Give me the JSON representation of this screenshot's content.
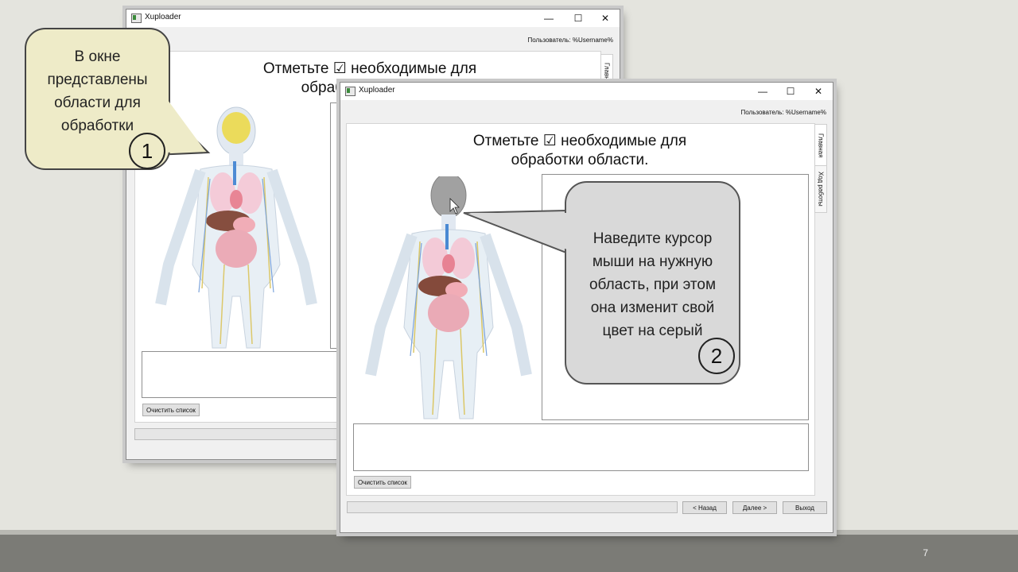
{
  "slide": {
    "page_number": "7"
  },
  "window_back": {
    "title": "Xuploader",
    "user_label": "Пользователь:  %Username%",
    "heading_line1": "Отметьте ☑ необходимые для",
    "heading_line2": "обработки области.",
    "tab_main": "Главная",
    "clear_button": "Очистить список"
  },
  "window_front": {
    "title": "Xuploader",
    "user_label": "Пользователь:  %Username%",
    "heading_line1": "Отметьте ☑ необходимые для",
    "heading_line2": "обработки области.",
    "tab_main": "Главная",
    "tab_progress": "Ход работы",
    "clear_button": "Очистить список",
    "back_button": "< Назад",
    "next_button": "Далее >",
    "exit_button": "Выход"
  },
  "window_controls": {
    "minimize": "—",
    "maximize": "☐",
    "close": "✕"
  },
  "callout_1": {
    "text_lines": [
      "В окне",
      "представлены",
      "области для",
      "обработки"
    ],
    "number": "1"
  },
  "callout_2": {
    "text_lines": [
      "Наведите курсор",
      "мыши на нужную",
      "область, при этом",
      "она изменит свой",
      "цвет на серый"
    ],
    "number": "2"
  },
  "colors": {
    "callout_1_fill": "#eeebc8",
    "callout_2_fill": "#d9d9d9",
    "footer": "#7b7b76"
  }
}
